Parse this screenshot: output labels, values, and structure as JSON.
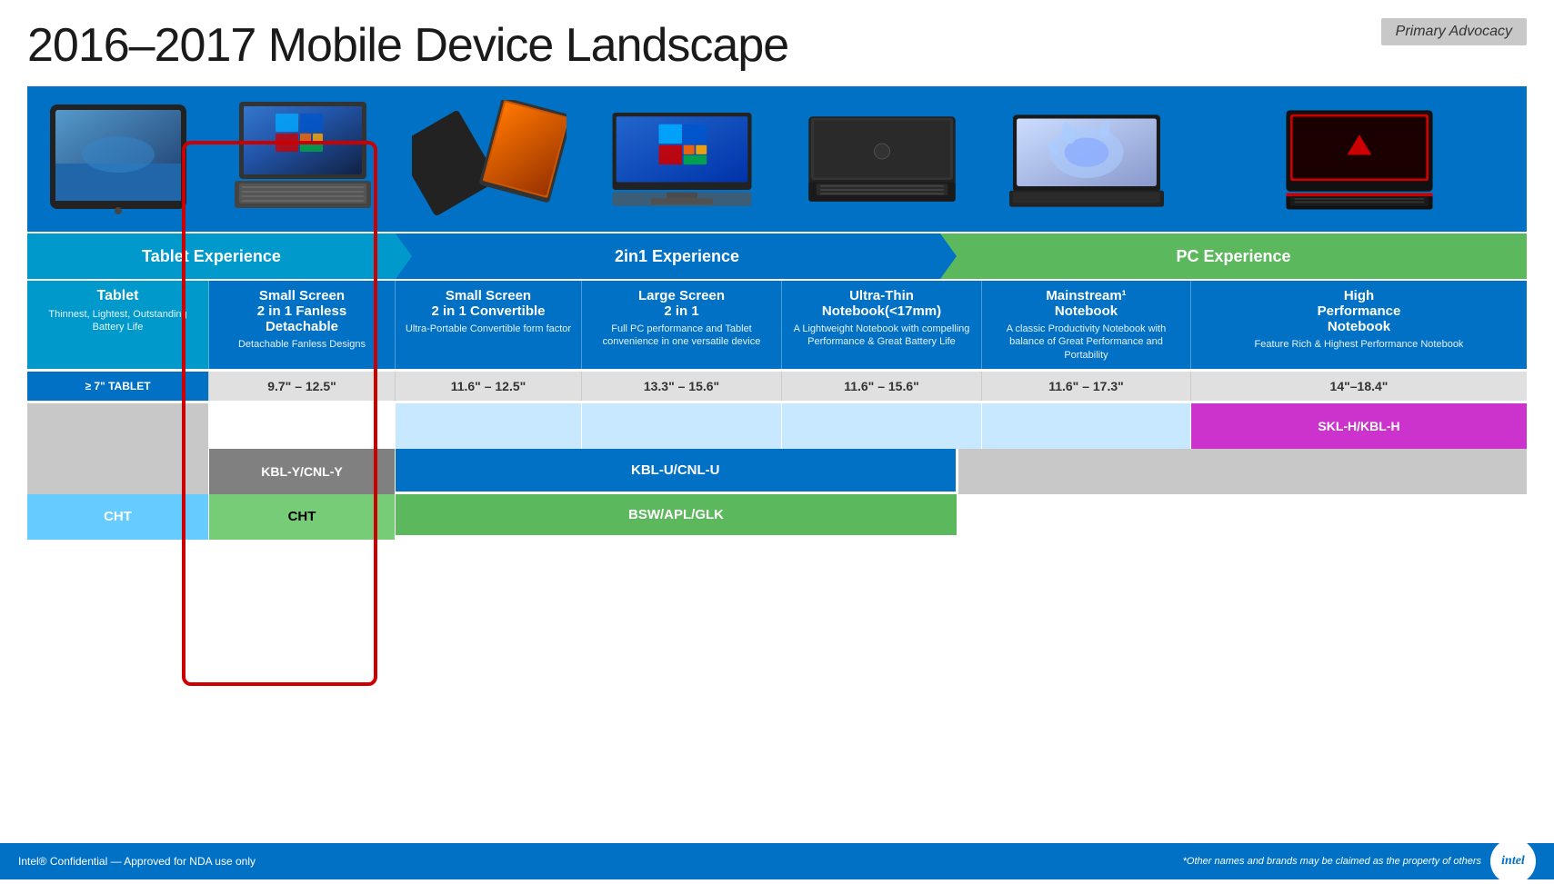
{
  "header": {
    "title": "2016–2017 Mobile Device Landscape",
    "badge": "Primary Advocacy"
  },
  "experience_bars": [
    {
      "label": "Tablet Experience",
      "type": "tablet"
    },
    {
      "label": "2in1 Experience",
      "type": "2in1"
    },
    {
      "label": "PC Experience",
      "type": "pc"
    }
  ],
  "columns": [
    {
      "id": "tablet",
      "name": "Tablet",
      "desc": "Thinnest, Lightest, Outstanding Battery Life",
      "size": "≥ 7\" TABLET",
      "size_bg": "blue"
    },
    {
      "id": "small-fanless",
      "name": "Small Screen\n2 in 1 Fanless\nDetachable",
      "desc": "Detachable Fanless Designs",
      "size": "9.7\" – 12.5\""
    },
    {
      "id": "small-conv",
      "name": "Small Screen\n2 in 1 Convertible",
      "desc": "Ultra-Portable Convertible form factor",
      "size": "11.6\" – 12.5\""
    },
    {
      "id": "large-2in1",
      "name": "Large Screen\n2 in 1",
      "desc": "Full PC performance and Tablet convenience in one versatile device",
      "size": "13.3\" – 15.6\""
    },
    {
      "id": "ultrathin",
      "name": "Ultra-Thin\nNotebook(<17mm)",
      "desc": "A Lightweight Notebook with compelling Performance & Great Battery Life",
      "size": "11.6\" – 15.6\""
    },
    {
      "id": "mainstream",
      "name": "Mainstream¹\nNotebook",
      "desc": "A classic Productivity Notebook with balance of Great Performance and Portability",
      "size": "11.6\" – 17.3\""
    },
    {
      "id": "highperf",
      "name": "High\nPerformance\nNotebook",
      "desc": "Feature Rich & Highest Performance Notebook",
      "size": "14\"–18.4\""
    }
  ],
  "processor_rows": [
    {
      "row_id": "top",
      "cells": [
        {
          "col": "tablet",
          "text": "",
          "bg": "light-gray"
        },
        {
          "col": "small-fanless",
          "text": "",
          "bg": "white"
        },
        {
          "col": "small-conv",
          "text": "",
          "bg": "light-blue"
        },
        {
          "col": "large-2in1",
          "text": "",
          "bg": "light-blue"
        },
        {
          "col": "ultrathin",
          "text": "",
          "bg": "light-blue"
        },
        {
          "col": "mainstream",
          "text": "",
          "bg": "light-blue"
        },
        {
          "col": "highperf",
          "text": "SKL-H/KBL-H",
          "bg": "magenta"
        }
      ]
    },
    {
      "row_id": "middle",
      "cells": [
        {
          "col": "tablet",
          "text": "",
          "bg": "light-gray"
        },
        {
          "col": "small-fanless-to-mainstream",
          "text": "KBL-Y/CNL-Y",
          "bg": "dark-gray",
          "span": 1
        },
        {
          "col": "conv-to-mainstream",
          "text": "KBL-U/CNL-U",
          "bg": "blue",
          "span": 5
        },
        {
          "col": "highperf",
          "text": "",
          "bg": "light-gray"
        }
      ]
    },
    {
      "row_id": "bottom",
      "cells": [
        {
          "col": "tablet",
          "text": "CHT",
          "bg": "light-blue"
        },
        {
          "col": "small-fanless",
          "text": "CHT",
          "bg": "light-green"
        },
        {
          "col": "conv-to-mainstream",
          "text": "BSW/APL/GLK",
          "bg": "green",
          "span": 5
        },
        {
          "col": "highperf",
          "text": "",
          "bg": "white"
        }
      ]
    }
  ],
  "footer": {
    "left": "Intel® Confidential — Approved for NDA use only",
    "right": "*Other names and brands may be claimed as the property of others",
    "logo": "intel"
  }
}
